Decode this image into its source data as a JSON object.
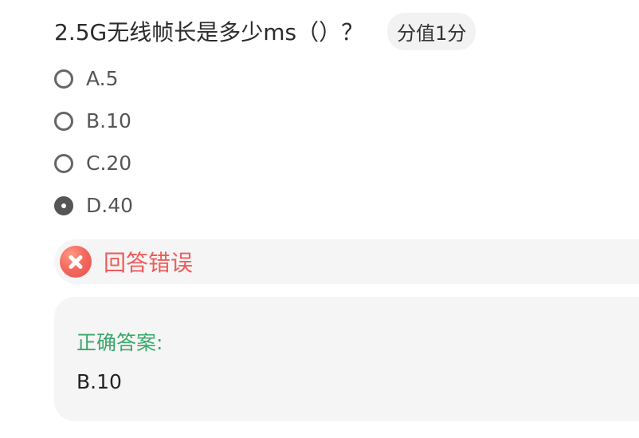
{
  "question": {
    "title": "2.5G无线帧长是多少ms（）？",
    "score_badge": "分值1分"
  },
  "options": [
    {
      "label": "A.5",
      "selected": false
    },
    {
      "label": "B.10",
      "selected": false
    },
    {
      "label": "C.20",
      "selected": false
    },
    {
      "label": "D.40",
      "selected": true
    }
  ],
  "result": {
    "text": "回答错误",
    "icon": "wrong-icon",
    "color": "#f05a5a"
  },
  "answer": {
    "heading": "正确答案:",
    "value": "B.10",
    "heading_color": "#3aa86a"
  }
}
